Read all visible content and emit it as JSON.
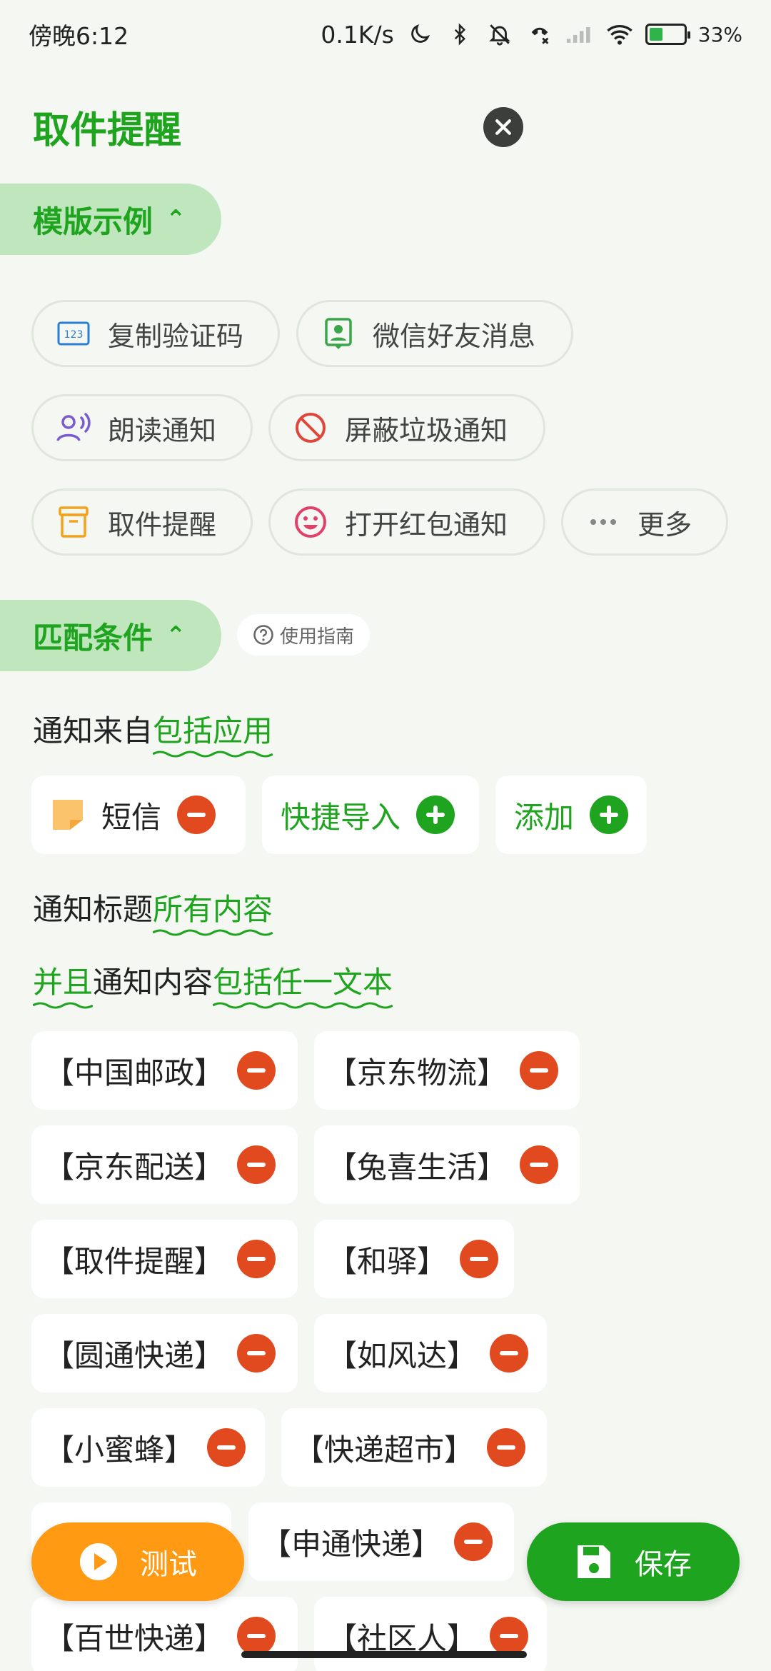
{
  "status_bar": {
    "time": "傍晚6:12",
    "speed": "0.1K/s",
    "battery": "33%"
  },
  "header": {
    "title": "取件提醒"
  },
  "templates_section": {
    "label": "模版示例",
    "chips": [
      {
        "label": "复制验证码",
        "icon": "numbers-icon",
        "color": "#2a7fd4"
      },
      {
        "label": "微信好友消息",
        "icon": "contact-icon",
        "color": "#3aa64a"
      },
      {
        "label": "朗读通知",
        "icon": "speaker-person-icon",
        "color": "#7a5bd0"
      },
      {
        "label": "屏蔽垃圾通知",
        "icon": "block-icon",
        "color": "#e0463a"
      },
      {
        "label": "取件提醒",
        "icon": "box-icon",
        "color": "#f3a21a"
      },
      {
        "label": "打开红包通知",
        "icon": "smile-icon",
        "color": "#e0406a"
      },
      {
        "label": "更多",
        "icon": "more-icon",
        "color": "#888888"
      }
    ]
  },
  "conditions_section": {
    "label": "匹配条件",
    "guide": "使用指南",
    "source_prefix": "通知来自",
    "source_value": "包括应用",
    "apps": [
      {
        "label": "短信"
      }
    ],
    "quick_import": "快捷导入",
    "add": "添加",
    "title_prefix": "通知标题",
    "title_value": "所有内容",
    "content_and": "并且",
    "content_prefix": "通知内容",
    "content_value": "包括任一文本",
    "keywords": [
      "【中国邮政】",
      "【京东物流】",
      "【京东配送】",
      "【兔喜生活】",
      "【取件提醒】",
      "【和驿】",
      "【圆通快递】",
      "【如风达】",
      "【小蜜蜂】",
      "【快递超市】",
      "【申通快递】",
      "【百世快递】",
      "【社区人】"
    ]
  },
  "actions": {
    "test": "测试",
    "save": "保存"
  }
}
